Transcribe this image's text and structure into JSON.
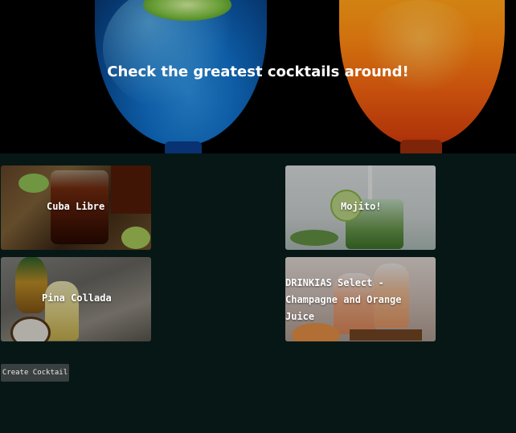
{
  "hero": {
    "title": "Check the greatest cocktails around!"
  },
  "cocktails": [
    {
      "name": "Cuba Libre"
    },
    {
      "name": "Mojito!"
    },
    {
      "name": "Pina Collada"
    },
    {
      "name": "DRINKIAS Select - Champagne and Orange Juice"
    }
  ],
  "actions": {
    "create_label": "Create Cocktail"
  },
  "colors": {
    "background": "#061716",
    "button": "#3a3f40"
  }
}
